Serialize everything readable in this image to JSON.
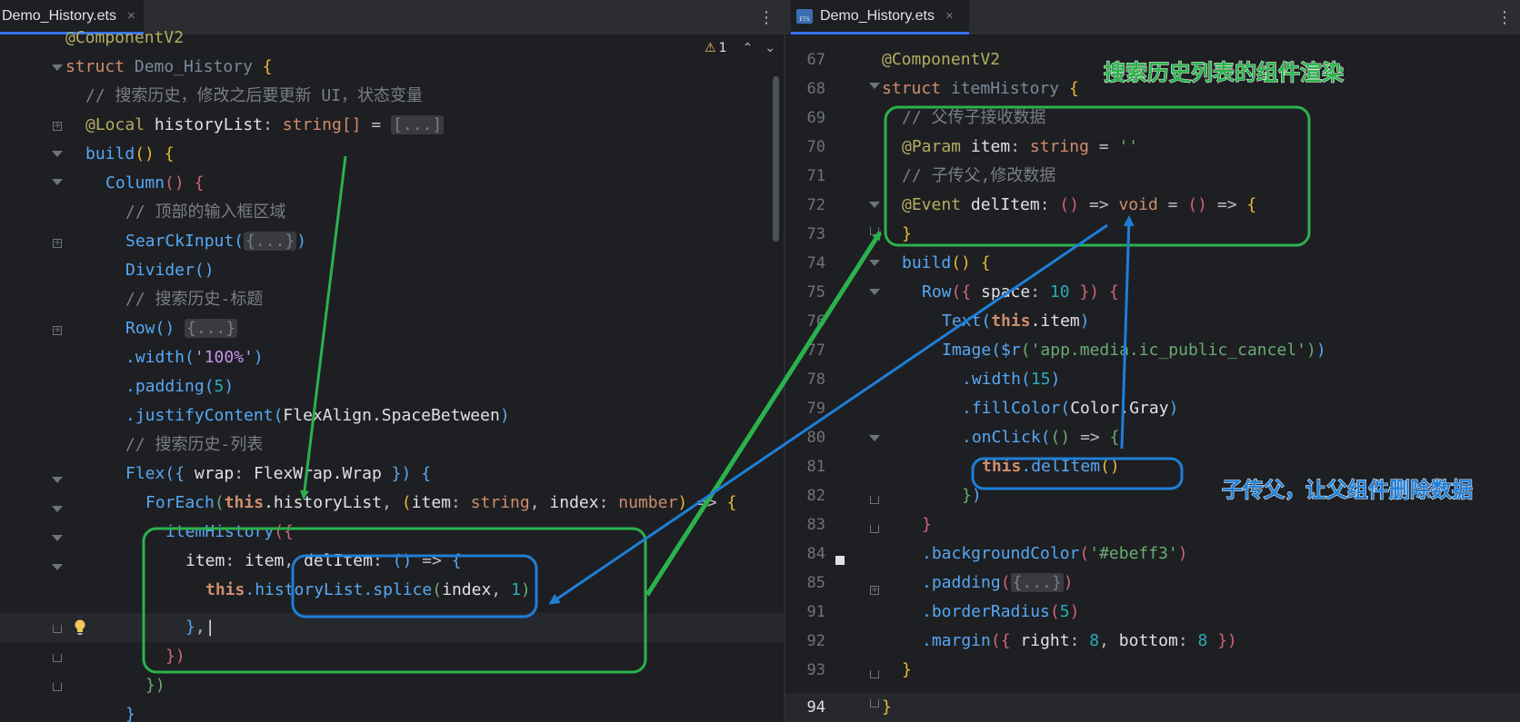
{
  "left_tab": {
    "title": "Demo_History.ets",
    "close": "×"
  },
  "right_tab": {
    "title": "Demo_History.ets",
    "badge": "ETS",
    "close": "×"
  },
  "inspection": {
    "count": "1"
  },
  "captions": {
    "green": "搜索历史列表的组件渲染",
    "blue": "子传父，让父组件删除数据"
  },
  "left_code": {
    "line1_annotation": "@ComponentV2",
    "struct_kw": "struct",
    "struct_name": "Demo_History",
    "comment_state": "// 搜索历史，修改之后要更新 UI，状态变量",
    "local_decorator": "@Local",
    "history_field": "historyList",
    "string_type": "string",
    "folded": "[...]",
    "build_fn": "build",
    "column_fn": "Column",
    "comment_top": "// 顶部的输入框区域",
    "search_input": "SearCkInput",
    "folded_obj": "{...}",
    "divider_fn": "Divider",
    "comment_title": "// 搜索历史-标题",
    "row_fn": "Row",
    "width_call": ".width",
    "width_val": "'100%'",
    "padding_call": ".padding",
    "padding_val": "5",
    "justify_call": ".justifyContent",
    "flexalign": "FlexAlign.SpaceBetween",
    "comment_list": "// 搜索历史-列表",
    "flex_fn": "Flex",
    "wrap_key": "wrap",
    "flexwrap": "FlexWrap.Wrap",
    "foreach_fn": "ForEach",
    "this_kw": "this",
    "history_ref": ".historyList",
    "item_param": "item",
    "index_param": "index",
    "number_type": "number",
    "item_history_fn": "itemHistory",
    "item_key": "item",
    "item_val": "item",
    "del_item_key": "delItem",
    "splice_call": ".historyList.splice",
    "splice_args_index": "index",
    "splice_args_count": "1"
  },
  "right_code": {
    "line_numbers": [
      "67",
      "68",
      "69",
      "70",
      "71",
      "72",
      "73",
      "74",
      "75",
      "76",
      "77",
      "78",
      "79",
      "80",
      "81",
      "82",
      "83",
      "84",
      "85",
      "91",
      "92",
      "93",
      "94"
    ],
    "annotation": "@ComponentV2",
    "struct_kw": "struct",
    "struct_name": "itemHistory",
    "comment_parent": "// 父传子接收数据",
    "param_decorator": "@Param",
    "item_field": "item",
    "string_type": "string",
    "empty_str": "''",
    "comment_child": "// 子传父,修改数据",
    "event_decorator": "@Event",
    "del_item_field": "delItem",
    "void_type": "void",
    "build_fn": "build",
    "row_fn": "Row",
    "space_key": "space",
    "space_val": "10",
    "text_fn": "Text",
    "this_kw": "this",
    "item_ref": ".item",
    "image_fn": "Image",
    "res_fn": "$r",
    "res_val": "'app.media.ic_public_cancel'",
    "width_call": ".width",
    "width_val": "15",
    "fill_call": ".fillColor",
    "fill_val": "Color.Gray",
    "onclick_call": ".onClick",
    "del_call": ".delItem",
    "bg_call": ".backgroundColor",
    "bg_val": "'#ebeff3'",
    "padding_call": ".padding",
    "folded_obj": "{...}",
    "radius_call": ".borderRadius",
    "radius_val": "5",
    "margin_call": ".margin",
    "right_key": "right",
    "right_val": "8",
    "bottom_key": "bottom",
    "bottom_val": "8"
  },
  "colors": {
    "editor_bg": "#1e1f22",
    "annotation_green": "#2bb24c",
    "annotation_blue": "#1e7fd8"
  }
}
